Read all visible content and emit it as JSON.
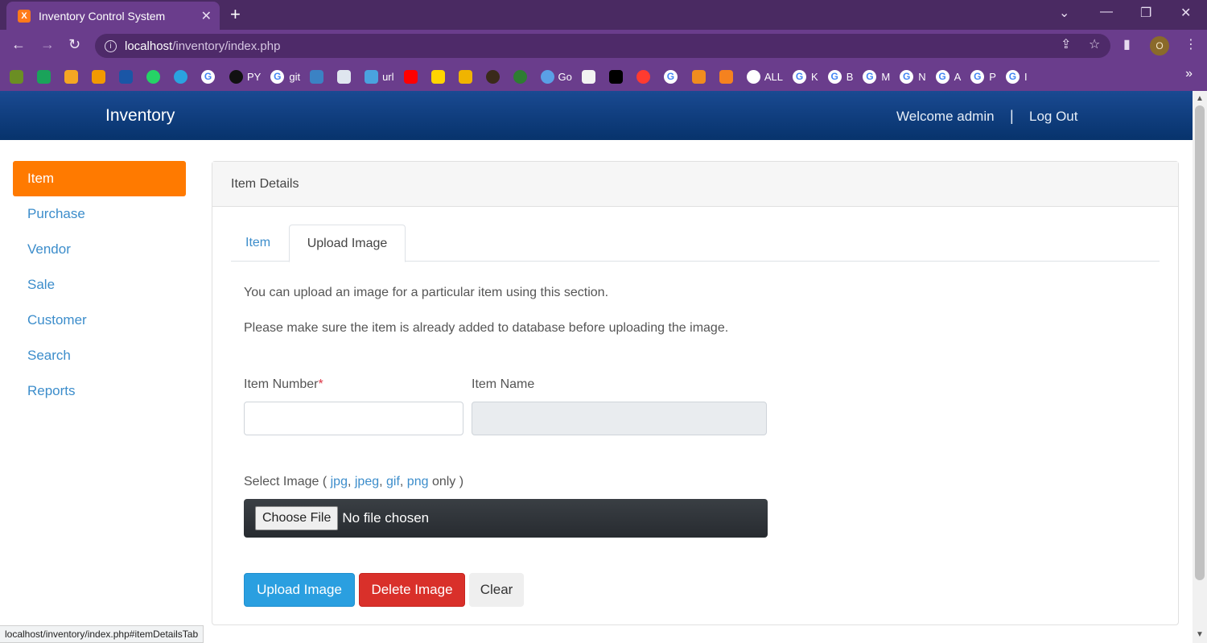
{
  "browser": {
    "tab_title": "Inventory Control System",
    "tab_favicon_letter": "X",
    "new_tab": "+",
    "url_host": "localhost",
    "url_path": "/inventory/index.php",
    "profile_initial": "O",
    "bookmarks": [
      "",
      "",
      "",
      "",
      "",
      "",
      "",
      "",
      "PY",
      "git",
      "",
      "",
      "url",
      "",
      "",
      "",
      "",
      "",
      "Go",
      "",
      "",
      "",
      "",
      "",
      "",
      "ALL",
      "K",
      "B",
      "M",
      "N",
      "A",
      "P",
      "I"
    ],
    "status_url": "localhost/inventory/index.php#itemDetailsTab"
  },
  "header": {
    "brand": "Inventory",
    "welcome": "Welcome admin",
    "separator": "|",
    "logout": "Log Out"
  },
  "sidebar": {
    "items": [
      {
        "label": "Item",
        "active": true
      },
      {
        "label": "Purchase"
      },
      {
        "label": "Vendor"
      },
      {
        "label": "Sale"
      },
      {
        "label": "Customer"
      },
      {
        "label": "Search"
      },
      {
        "label": "Reports"
      }
    ]
  },
  "panel": {
    "title": "Item Details",
    "tabs": [
      "Item",
      "Upload Image"
    ],
    "para1": "You can upload an image for a particular item using this section.",
    "para2": "Please make sure the item is already added to database before uploading the image.",
    "item_number_label": "Item Number",
    "required_mark": "*",
    "item_name_label": "Item Name",
    "select_image_label": "Select Image ( ",
    "extensions": [
      "jpg",
      "jpeg",
      "gif",
      "png"
    ],
    "select_image_suffix": " only )",
    "choose_file": "Choose File",
    "no_file": "No file chosen",
    "buttons": {
      "upload": "Upload Image",
      "delete": "Delete Image",
      "clear": "Clear"
    }
  },
  "colors": {
    "header_blue": "#07336c",
    "accent_orange": "#ff7a00",
    "link_blue": "#3c8dcb",
    "upload_blue": "#2a9fe0",
    "delete_red": "#d9302a",
    "chrome_purple": "#6a3d8c"
  }
}
